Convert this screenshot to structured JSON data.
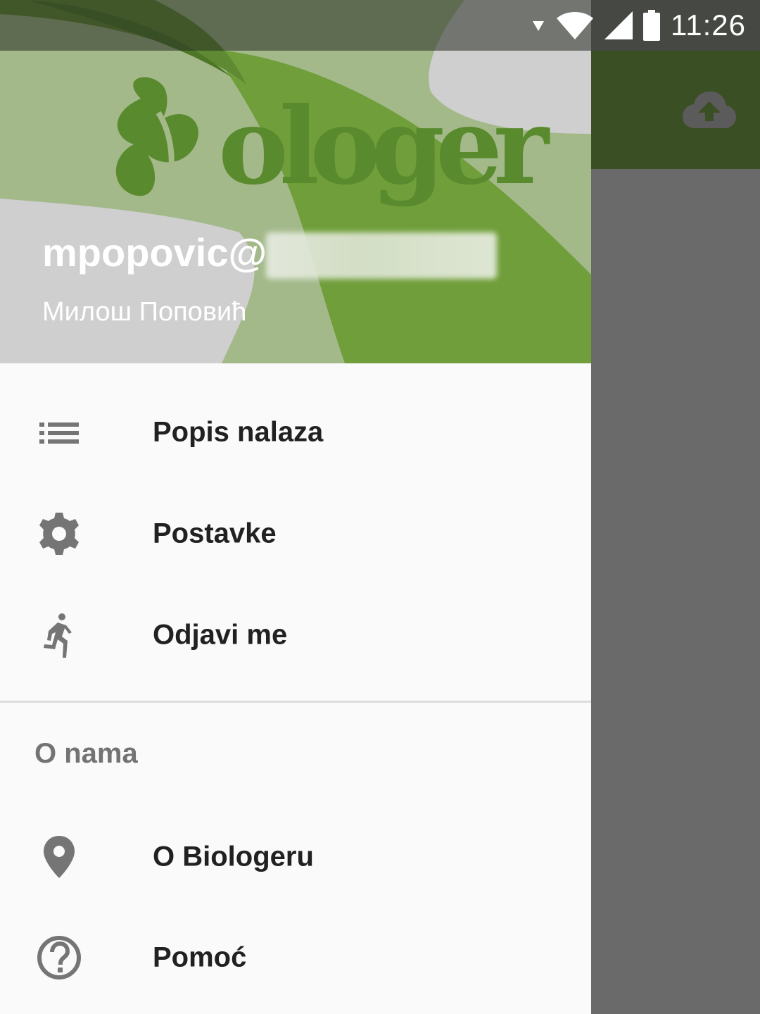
{
  "status_bar": {
    "time": "11:26",
    "icons": [
      "data-arrow-icon",
      "wifi-icon",
      "signal-icon",
      "battery-icon"
    ]
  },
  "app": {
    "toolbar_color": "#3a4f23",
    "upload_icon": "cloud-upload-icon"
  },
  "drawer": {
    "header": {
      "logo_text": "Biologer",
      "user_email": "mpopovic@",
      "user_name": "Милош Поповић"
    },
    "items": [
      {
        "icon": "list-icon",
        "label": "Popis nalaza"
      },
      {
        "icon": "gear-icon",
        "label": "Postavke"
      },
      {
        "icon": "running-person-icon",
        "label": "Odjavi me"
      }
    ],
    "section_header": "O nama",
    "section_items": [
      {
        "icon": "location-pin-icon",
        "label": "O Biologeru"
      },
      {
        "icon": "help-circle-icon",
        "label": "Pomoć"
      }
    ]
  },
  "colors": {
    "brand_green": "#5a8a2e",
    "header_green": "#6f9e3a",
    "icon_gray": "#757575",
    "text_dark": "#212121"
  }
}
